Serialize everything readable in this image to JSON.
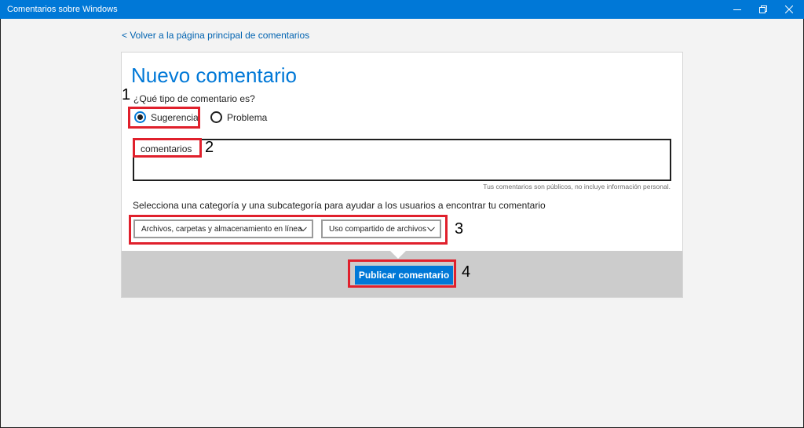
{
  "window": {
    "title": "Comentarios sobre Windows",
    "controls": [
      "minimize-icon",
      "restore-icon",
      "close-icon"
    ]
  },
  "nav": {
    "back_link": "< Volver a la página principal de comentarios"
  },
  "form": {
    "title": "Nuevo comentario",
    "question": "¿Qué tipo de comentario es?",
    "type_options": [
      {
        "label": "Sugerencia",
        "selected": true
      },
      {
        "label": "Problema",
        "selected": false
      }
    ],
    "comment_value": "comentarios",
    "privacy_hint": "Tus comentarios son públicos, no incluye información personal.",
    "category_label": "Selecciona una categoría y una subcategoría para ayudar a los usuarios a encontrar tu comentario",
    "category_selected": "Archivos, carpetas y almacenamiento en línea",
    "subcategory_selected": "Uso compartido de archivos",
    "publish_label": "Publicar comentario"
  },
  "annotations": {
    "marker_1": "1",
    "marker_2": "2",
    "marker_3": "3",
    "marker_4": "4",
    "color": "#e0202c"
  },
  "colors": {
    "accent": "#0078d7",
    "link": "#0063b1",
    "footer": "#cccccc",
    "background": "#f3f3f3"
  }
}
